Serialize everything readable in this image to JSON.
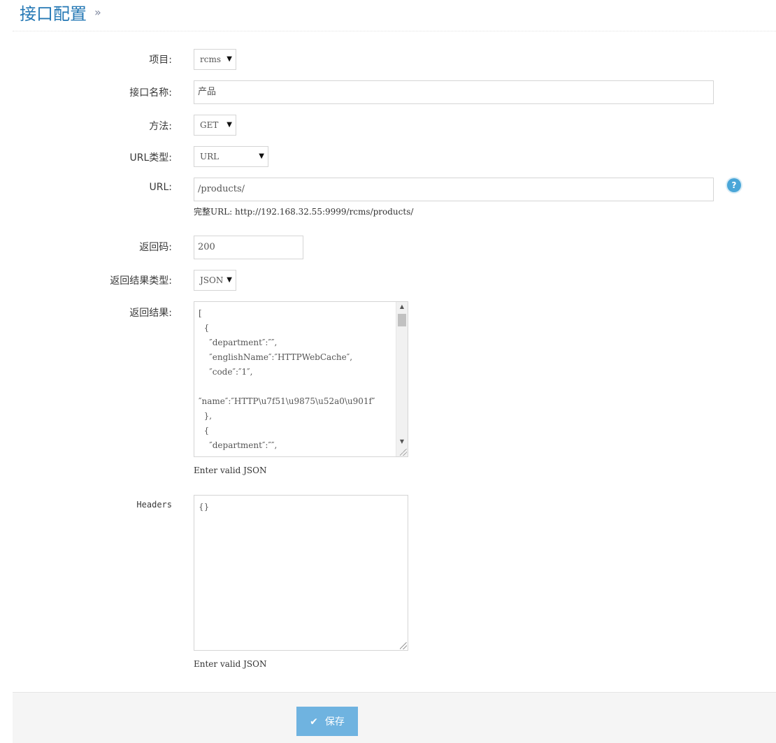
{
  "header": {
    "title": "接口配置",
    "separator": "»"
  },
  "form": {
    "project": {
      "label": "项目:",
      "value": "rcms"
    },
    "api_name": {
      "label": "接口名称:",
      "value": "产品"
    },
    "method": {
      "label": "方法:",
      "value": "GET"
    },
    "url_type": {
      "label": "URL类型:",
      "value": "URL"
    },
    "url": {
      "label": "URL:",
      "value": "/products/",
      "help": "完整URL: http://192.168.32.55:9999/rcms/products/",
      "help_icon": "?"
    },
    "status_code": {
      "label": "返回码:",
      "value": "200"
    },
    "result_type": {
      "label": "返回结果类型:",
      "value": "JSON"
    },
    "result": {
      "label": "返回结果:",
      "value": "[\n  {\n    ″department″:″″,\n    ″englishName″:″HTTPWebCache″,\n    ″code″:″1″,\n\n″name″:″HTTP\\u7f51\\u9875\\u52a0\\u901f″\n  },\n  {\n    ″department″:″″,\n    ″englishName″:″\n",
      "hint": "Enter valid JSON"
    },
    "headers": {
      "label": "Headers",
      "value": "{}",
      "hint": "Enter valid JSON"
    }
  },
  "footer": {
    "save_label": "保存"
  },
  "colors": {
    "accent": "#2679b5",
    "button": "#6fb3e0"
  }
}
